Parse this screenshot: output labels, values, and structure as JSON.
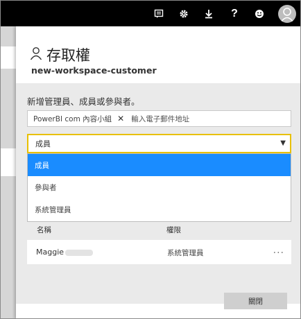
{
  "header": {
    "buttons": [
      {
        "icon": "feedback-icon"
      },
      {
        "icon": "gear-icon"
      },
      {
        "icon": "download-icon"
      },
      {
        "icon": "help-icon",
        "glyph": "?"
      },
      {
        "icon": "smiley-icon"
      },
      {
        "icon": "user-avatar-icon"
      }
    ]
  },
  "panel": {
    "title_icon": "person-icon",
    "title": "存取權",
    "subtitle": "new-workspace-customer",
    "add_label": "新增管理員、成員或參與者。",
    "email_chip": "PowerBI com 內容小組",
    "email_chip_remove": "✕",
    "email_placeholder": "輸入電子郵件地址",
    "role_select": {
      "value": "成員",
      "options": [
        "成員",
        "參與者",
        "系統管理員"
      ],
      "selected_index": 0
    },
    "table": {
      "columns": [
        "名稱",
        "權限"
      ],
      "rows": [
        {
          "name": "Maggie",
          "permission": "系統管理員",
          "more": "..."
        }
      ]
    },
    "close_label": "關閉"
  },
  "colors": {
    "topbar": "#000000",
    "select_border": "#e8c000",
    "dropdown_selected": "#1a8cff",
    "panel_grey": "#eaeaea"
  }
}
